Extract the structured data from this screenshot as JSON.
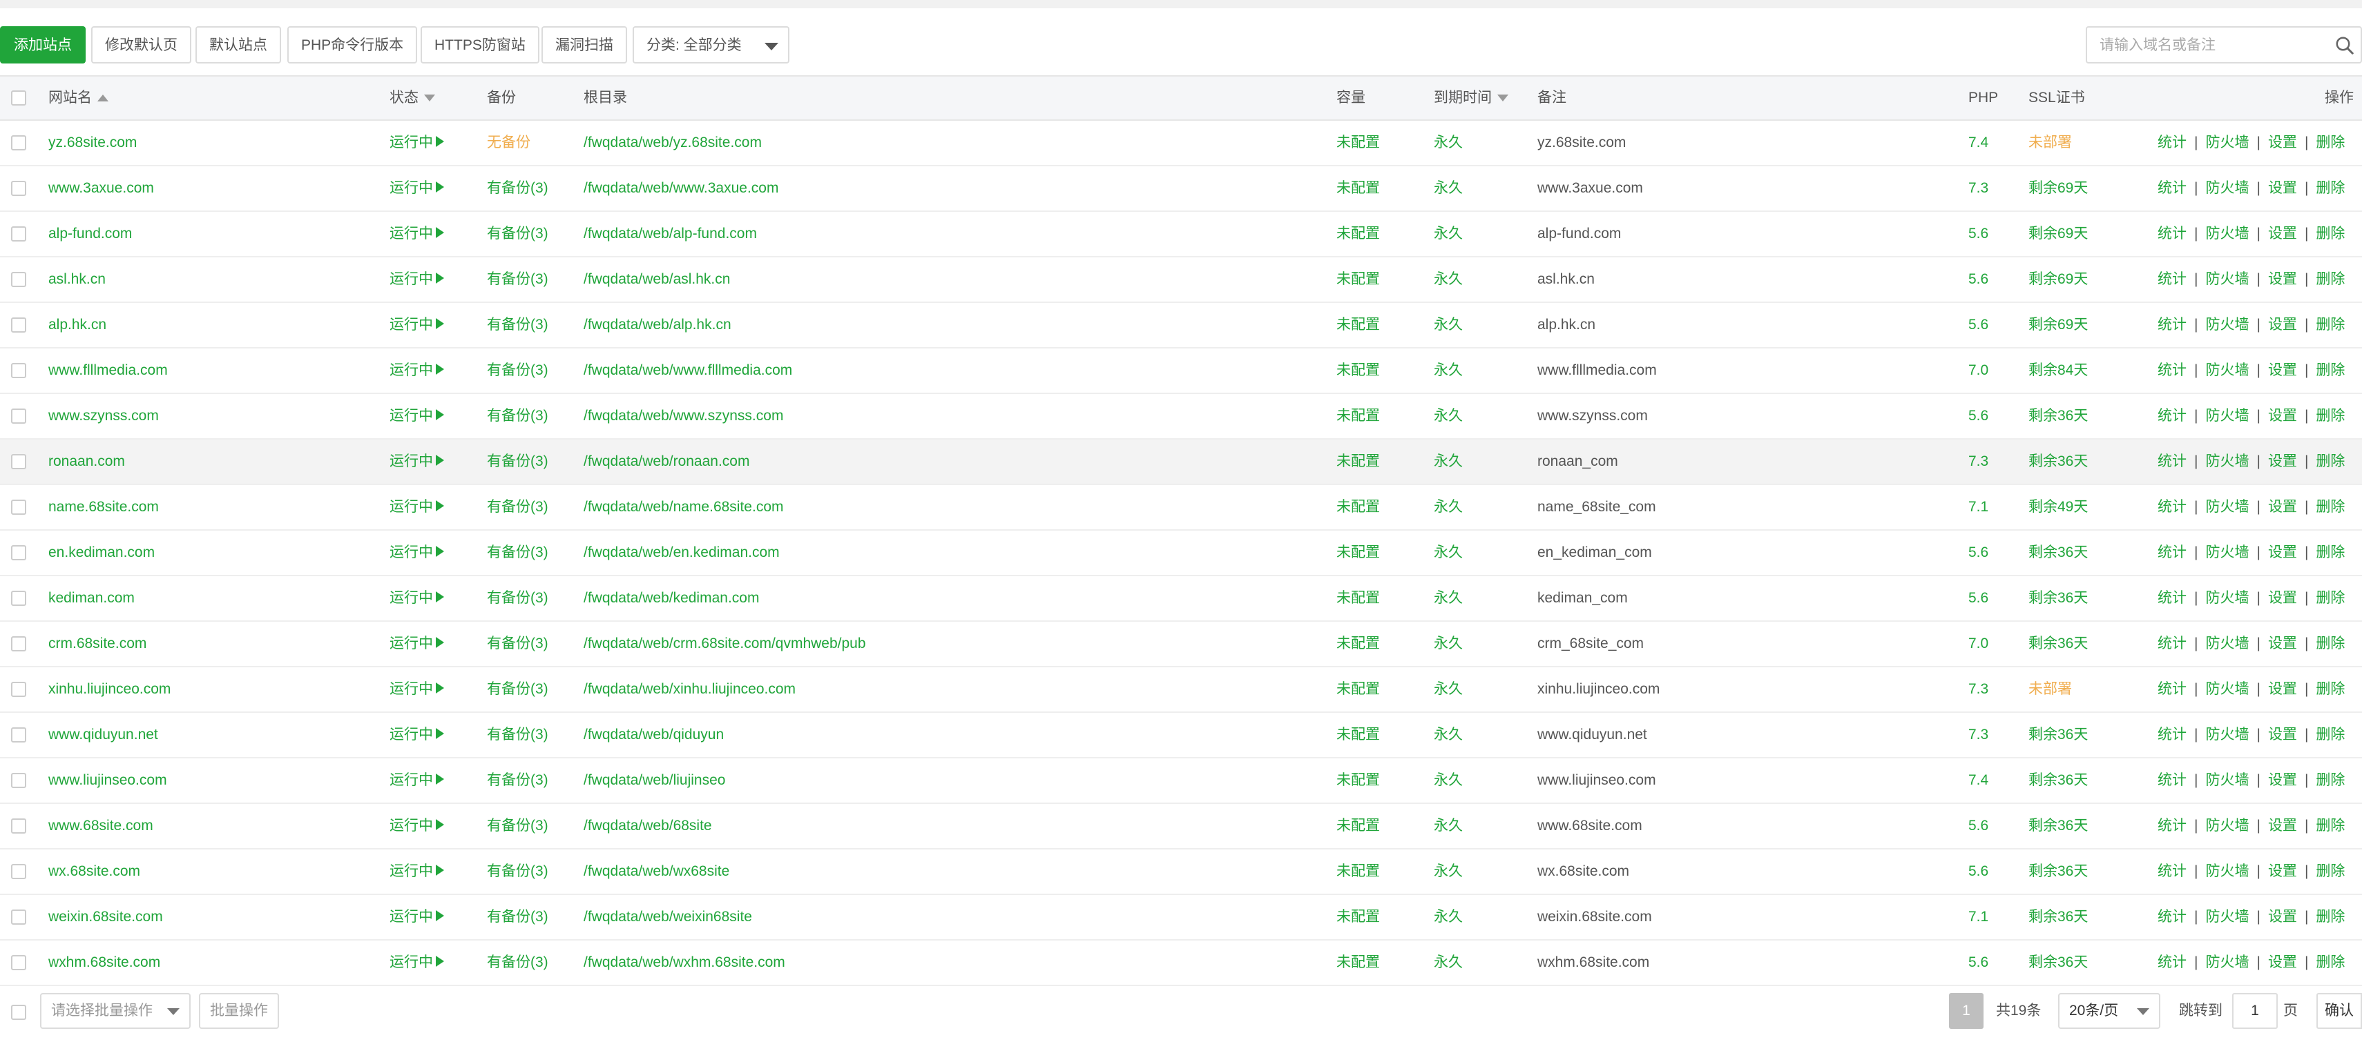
{
  "toolbar": {
    "add_site": "添加站点",
    "edit_default_page": "修改默认页",
    "default_site": "默认站点",
    "php_cli_version": "PHP命令行版本",
    "https_protection": "HTTPS防窗站",
    "vuln_scan": "漏洞扫描",
    "category": "分类: 全部分类",
    "search_placeholder": "请输入域名或备注"
  },
  "table": {
    "headers": {
      "site_name": "网站名",
      "status": "状态",
      "backup": "备份",
      "root": "根目录",
      "capacity": "容量",
      "expire": "到期时间",
      "remark": "备注",
      "php": "PHP",
      "ssl": "SSL证书",
      "actions": "操作"
    },
    "actions": [
      "统计",
      "防火墙",
      "设置",
      "删除"
    ],
    "rows": [
      {
        "name": "yz.68site.com",
        "status": "运行中",
        "backup": "无备份",
        "backup_none": true,
        "root": "/fwqdata/web/yz.68site.com",
        "capacity": "未配置",
        "expire": "永久",
        "remark": "yz.68site.com",
        "php": "7.4",
        "ssl": "未部署",
        "ssl_warn": true
      },
      {
        "name": "www.3axue.com",
        "status": "运行中",
        "backup": "有备份(3)",
        "root": "/fwqdata/web/www.3axue.com",
        "capacity": "未配置",
        "expire": "永久",
        "remark": "www.3axue.com",
        "php": "7.3",
        "ssl": "剩余69天"
      },
      {
        "name": "alp-fund.com",
        "status": "运行中",
        "backup": "有备份(3)",
        "root": "/fwqdata/web/alp-fund.com",
        "capacity": "未配置",
        "expire": "永久",
        "remark": "alp-fund.com",
        "php": "5.6",
        "ssl": "剩余69天"
      },
      {
        "name": "asl.hk.cn",
        "status": "运行中",
        "backup": "有备份(3)",
        "root": "/fwqdata/web/asl.hk.cn",
        "capacity": "未配置",
        "expire": "永久",
        "remark": "asl.hk.cn",
        "php": "5.6",
        "ssl": "剩余69天"
      },
      {
        "name": "alp.hk.cn",
        "status": "运行中",
        "backup": "有备份(3)",
        "root": "/fwqdata/web/alp.hk.cn",
        "capacity": "未配置",
        "expire": "永久",
        "remark": "alp.hk.cn",
        "php": "5.6",
        "ssl": "剩余69天"
      },
      {
        "name": "www.flllmedia.com",
        "status": "运行中",
        "backup": "有备份(3)",
        "root": "/fwqdata/web/www.flllmedia.com",
        "capacity": "未配置",
        "expire": "永久",
        "remark": "www.flllmedia.com",
        "php": "7.0",
        "ssl": "剩余84天"
      },
      {
        "name": "www.szynss.com",
        "status": "运行中",
        "backup": "有备份(3)",
        "root": "/fwqdata/web/www.szynss.com",
        "capacity": "未配置",
        "expire": "永久",
        "remark": "www.szynss.com",
        "php": "5.6",
        "ssl": "剩余36天"
      },
      {
        "name": "ronaan.com",
        "status": "运行中",
        "backup": "有备份(3)",
        "root": "/fwqdata/web/ronaan.com",
        "capacity": "未配置",
        "expire": "永久",
        "remark": "ronaan_com",
        "php": "7.3",
        "ssl": "剩余36天",
        "highlight": true
      },
      {
        "name": "name.68site.com",
        "status": "运行中",
        "backup": "有备份(3)",
        "root": "/fwqdata/web/name.68site.com",
        "capacity": "未配置",
        "expire": "永久",
        "remark": "name_68site_com",
        "php": "7.1",
        "ssl": "剩余49天"
      },
      {
        "name": "en.kediman.com",
        "status": "运行中",
        "backup": "有备份(3)",
        "root": "/fwqdata/web/en.kediman.com",
        "capacity": "未配置",
        "expire": "永久",
        "remark": "en_kediman_com",
        "php": "5.6",
        "ssl": "剩余36天"
      },
      {
        "name": "kediman.com",
        "status": "运行中",
        "backup": "有备份(3)",
        "root": "/fwqdata/web/kediman.com",
        "capacity": "未配置",
        "expire": "永久",
        "remark": "kediman_com",
        "php": "5.6",
        "ssl": "剩余36天"
      },
      {
        "name": "crm.68site.com",
        "status": "运行中",
        "backup": "有备份(3)",
        "root": "/fwqdata/web/crm.68site.com/qvmhweb/pub",
        "capacity": "未配置",
        "expire": "永久",
        "remark": "crm_68site_com",
        "php": "7.0",
        "ssl": "剩余36天"
      },
      {
        "name": "xinhu.liujinceo.com",
        "status": "运行中",
        "backup": "有备份(3)",
        "root": "/fwqdata/web/xinhu.liujinceo.com",
        "capacity": "未配置",
        "expire": "永久",
        "remark": "xinhu.liujinceo.com",
        "php": "7.3",
        "ssl": "未部署",
        "ssl_warn": true
      },
      {
        "name": "www.qiduyun.net",
        "status": "运行中",
        "backup": "有备份(3)",
        "root": "/fwqdata/web/qiduyun",
        "capacity": "未配置",
        "expire": "永久",
        "remark": "www.qiduyun.net",
        "php": "7.3",
        "ssl": "剩余36天"
      },
      {
        "name": "www.liujinseo.com",
        "status": "运行中",
        "backup": "有备份(3)",
        "root": "/fwqdata/web/liujinseo",
        "capacity": "未配置",
        "expire": "永久",
        "remark": "www.liujinseo.com",
        "php": "7.4",
        "ssl": "剩余36天"
      },
      {
        "name": "www.68site.com",
        "status": "运行中",
        "backup": "有备份(3)",
        "root": "/fwqdata/web/68site",
        "capacity": "未配置",
        "expire": "永久",
        "remark": "www.68site.com",
        "php": "5.6",
        "ssl": "剩余36天"
      },
      {
        "name": "wx.68site.com",
        "status": "运行中",
        "backup": "有备份(3)",
        "root": "/fwqdata/web/wx68site",
        "capacity": "未配置",
        "expire": "永久",
        "remark": "wx.68site.com",
        "php": "5.6",
        "ssl": "剩余36天"
      },
      {
        "name": "weixin.68site.com",
        "status": "运行中",
        "backup": "有备份(3)",
        "root": "/fwqdata/web/weixin68site",
        "capacity": "未配置",
        "expire": "永久",
        "remark": "weixin.68site.com",
        "php": "7.1",
        "ssl": "剩余36天"
      },
      {
        "name": "wxhm.68site.com",
        "status": "运行中",
        "backup": "有备份(3)",
        "root": "/fwqdata/web/wxhm.68site.com",
        "capacity": "未配置",
        "expire": "永久",
        "remark": "wxhm.68site.com",
        "php": "5.6",
        "ssl": "剩余36天"
      }
    ]
  },
  "footer": {
    "batch_placeholder": "请选择批量操作",
    "batch_button": "批量操作",
    "current_page": "1",
    "total": "共19条",
    "per_page": "20条/页",
    "jump_label": "跳转到",
    "jump_value": "1",
    "page_unit": "页",
    "confirm": "确认"
  },
  "colors": {
    "primary": "#20a53a",
    "warning": "#f0ad4e"
  }
}
